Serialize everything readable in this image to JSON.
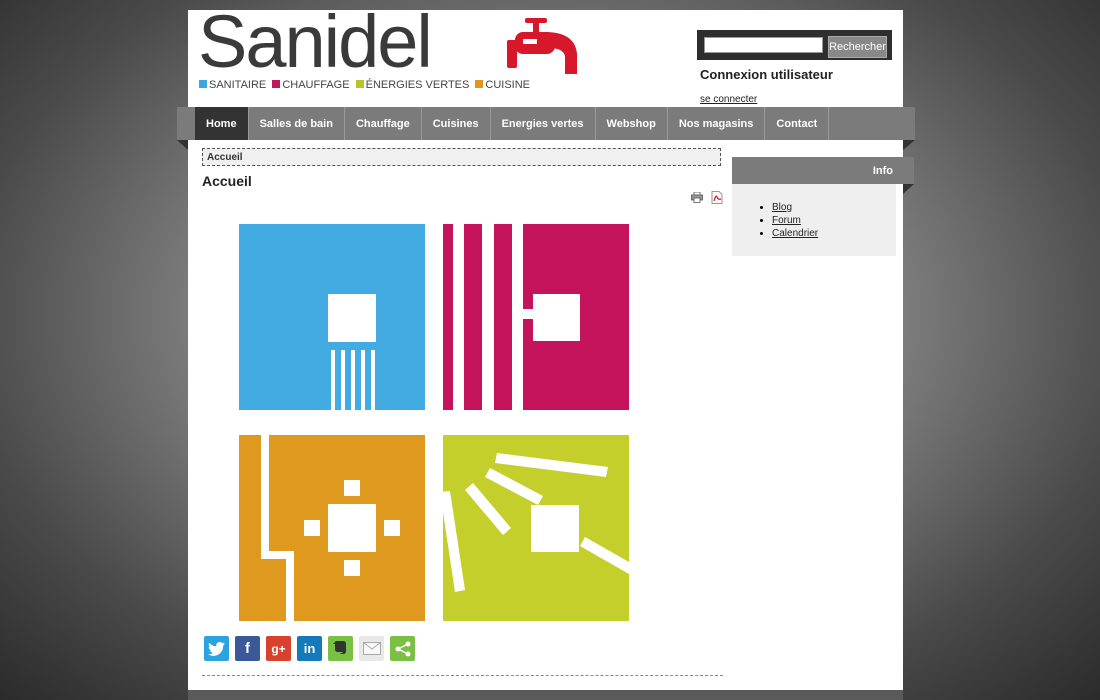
{
  "header": {
    "logo_text": "Sanidel",
    "tagline": [
      {
        "label": "SANITAIRE",
        "color": "#3aa7e0"
      },
      {
        "label": "CHAUFFAGE",
        "color": "#c2185b"
      },
      {
        "label": "ÉNERGIES VERTES",
        "color": "#b5c52a"
      },
      {
        "label": "CUISINE",
        "color": "#e0951f"
      }
    ],
    "brand_red": "#d7182a"
  },
  "search": {
    "placeholder": "",
    "button_label": "Rechercher"
  },
  "login": {
    "title": "Connexion utilisateur",
    "link": "se connecter"
  },
  "nav": {
    "items": [
      "Home",
      "Salles de bain",
      "Chauffage",
      "Cuisines",
      "Energies vertes",
      "Webshop",
      "Nos magasins",
      "Contact"
    ],
    "active": "Home"
  },
  "breadcrumb": "Accueil",
  "page_title": "Accueil",
  "tools": {
    "print_icon": "printer-icon",
    "pdf_icon": "pdf-icon"
  },
  "tiles": {
    "colors": {
      "blue": "#42ace2",
      "magenta": "#c5145c",
      "orange": "#e0991f",
      "green": "#c4cf2c"
    }
  },
  "social": [
    "twitter-icon",
    "facebook-icon",
    "google-plus-icon",
    "linkedin-icon",
    "evernote-icon",
    "email-icon",
    "share-icon"
  ],
  "sidebar": {
    "title": "Info",
    "links": [
      "Blog",
      "Forum",
      "Calendrier"
    ]
  }
}
